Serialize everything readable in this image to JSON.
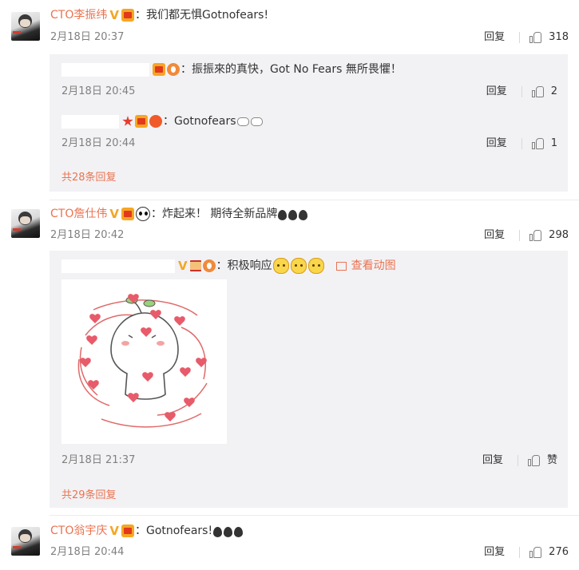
{
  "actions": {
    "reply_label": "回复"
  },
  "comments": [
    {
      "username": "CTO李振纬",
      "text": "：我们都无惧Gotnofears!",
      "date": "2月18日 20:37",
      "likes": "318",
      "replies": [
        {
          "text": "：振振來的真快，Got No Fears  無所畏懼！",
          "date": "2月18日 20:45",
          "likes": "2"
        },
        {
          "text": "：Gotnofears",
          "date": "2月18日 20:44",
          "likes": "1"
        }
      ],
      "total_replies": "共28条回复"
    },
    {
      "username": "CTO詹仕伟",
      "text": "：炸起来！ 期待全新品牌",
      "date": "2月18日 20:42",
      "likes": "298",
      "replies": [
        {
          "text": "：积极响应",
          "view_gif": "查看动图",
          "date": "2月18日 21:37",
          "likes": "赞"
        }
      ],
      "total_replies": "共29条回复"
    },
    {
      "username": "CTO翁宇庆",
      "text": "：Gotnofears!",
      "date": "2月18日 20:44",
      "likes": "276"
    }
  ]
}
